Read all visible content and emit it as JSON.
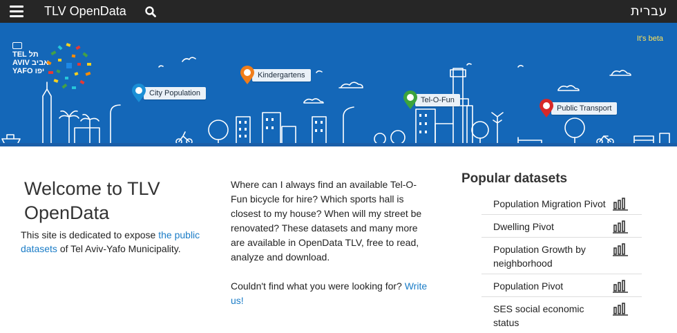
{
  "topbar": {
    "brand": "TLV OpenData",
    "language": "עברית"
  },
  "banner": {
    "beta": "It's beta",
    "logo_lines": [
      "TEL",
      "AVIV",
      "YAFO"
    ],
    "logo_hebrew": [
      "תל",
      "אביב",
      "יפו"
    ],
    "pins": [
      {
        "label": "City Population",
        "color": "#1a8fd6"
      },
      {
        "label": "Kindergartens",
        "color": "#f07d1a"
      },
      {
        "label": "Tel-O-Fun",
        "color": "#3ca33c"
      },
      {
        "label": "Public Transport",
        "color": "#d62828"
      }
    ]
  },
  "welcome": {
    "title": "Welcome to TLV OpenData",
    "intro_before": "This site is dedicated to expose ",
    "intro_link": "the public datasets",
    "intro_after": " of Tel Aviv-Yafo Municipality."
  },
  "middle": {
    "paragraph": "Where can I always find an available Tel-O-Fun bicycle for hire? Which sports hall is closest to my house? When will my street be renovated? These datasets and many more are available in OpenData TLV, free to read, analyze and download.",
    "contact_before": "Couldn't find what you were looking for? ",
    "contact_link": "Write us!"
  },
  "popular": {
    "title": "Popular datasets",
    "items": [
      {
        "name": "Population Migration Pivot"
      },
      {
        "name": "Dwelling Pivot"
      },
      {
        "name": "Population Growth by neighborhood"
      },
      {
        "name": "Population Pivot"
      },
      {
        "name": "SES social economic status"
      }
    ]
  },
  "icons": {
    "menu": "hamburger-icon",
    "search": "search-icon",
    "dataset": "bar-chart-icon",
    "pin": "map-pin-icon"
  }
}
